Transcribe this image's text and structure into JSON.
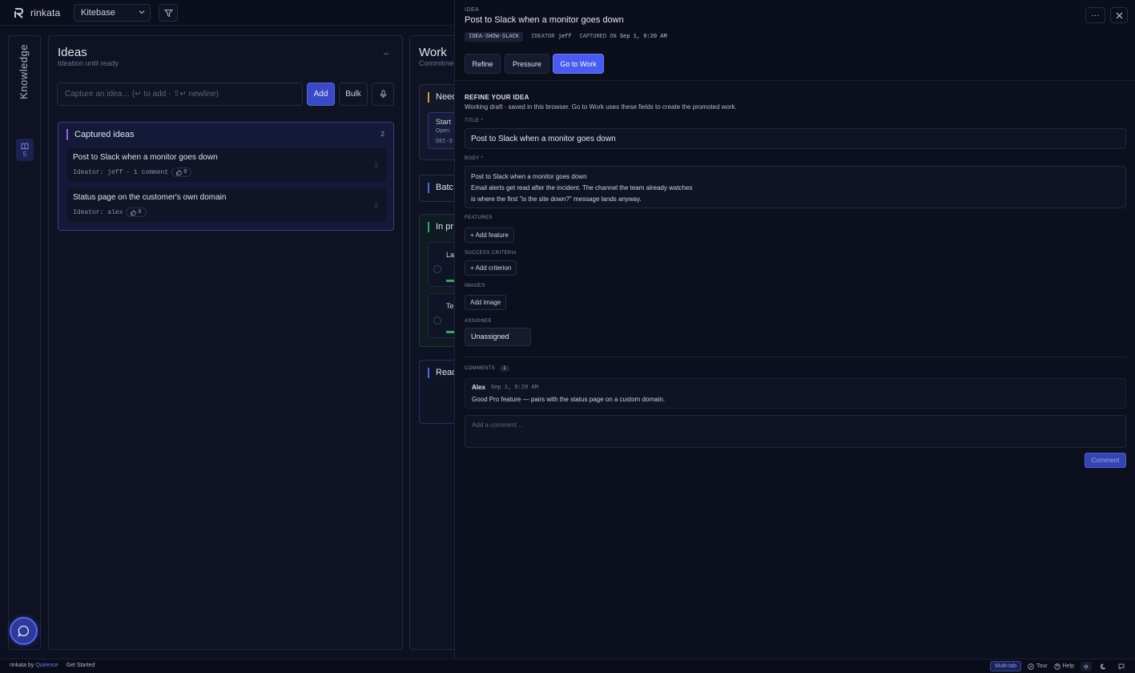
{
  "app": {
    "name": "rinkata"
  },
  "topbar": {
    "workspace": "Kitebase"
  },
  "rail": {
    "label": "Knowledge",
    "count": "5"
  },
  "ideas": {
    "title": "Ideas",
    "subtitle": "Ideation until ready",
    "collapse": "–",
    "capture_placeholder": "Capture an idea… (↵ to add · ⇧↵ newline)",
    "add_label": "Add",
    "bulk_label": "Bulk",
    "captured": {
      "title": "Captured ideas",
      "count": "2",
      "items": [
        {
          "title": "Post to Slack when a monitor goes down",
          "ideator": "Ideator: jeff",
          "comments": "· 1 comment",
          "votes": "0"
        },
        {
          "title": "Status page on the customer's own domain",
          "ideator": "Ideator: alex",
          "comments": "",
          "votes": "0"
        }
      ]
    }
  },
  "work": {
    "title": "Work",
    "subtitle": "Commitments",
    "sections": [
      {
        "label": "Need",
        "color": "#c9a23a"
      },
      {
        "label": "Batc",
        "color": "#4a6ae6"
      },
      {
        "label": "In pr",
        "color": "#2fa86a"
      },
      {
        "label": "Read",
        "color": "#4a6ae6"
      }
    ],
    "snippets": {
      "start": "Start",
      "open": "Open",
      "code": "DEC-S",
      "la": "La",
      "te": "Te"
    }
  },
  "drawer": {
    "kind": "IDEA",
    "title": "Post to Slack when a monitor goes down",
    "tag": "IDEA-SHOW-SLACK",
    "ideator_label": "IDEATOR",
    "ideator": "jeff",
    "captured_label": "CAPTURED ON",
    "captured": "Sep 1, 9:20 AM",
    "more": "···",
    "tabs": {
      "refine": "Refine",
      "pressure": "Pressure",
      "gotowork": "Go to Work"
    },
    "section_title": "REFINE YOUR IDEA",
    "section_sub": "Working draft · saved in this browser. Go to Work uses these fields to create the promoted work.",
    "title_label": "TITLE *",
    "title_value": "Post to Slack when a monitor goes down",
    "body_label": "BODY *",
    "body_lines": [
      "Post to Slack when a monitor goes down",
      "Email alerts get read after the incident. The channel the team already watches",
      "is where the first \"is the site down?\" message lands anyway."
    ],
    "features_label": "FEATURES",
    "add_feature": "+ Add feature",
    "criteria_label": "SUCCESS CRITERIA",
    "add_criterion": "+ Add criterion",
    "images_label": "IMAGES",
    "add_image": "Add image",
    "assignee_label": "ASSIGNEE",
    "assignee": "Unassigned",
    "comments_label": "COMMENTS",
    "comments_count": "1",
    "comment": {
      "author": "Alex",
      "time": "Sep 1, 9:20 AM",
      "text": "Good Pro feature — pairs with the status page on a custom domain."
    },
    "comment_placeholder": "Add a comment…",
    "comment_btn": "Comment"
  },
  "statusbar": {
    "by_prefix": "rinkata by",
    "brand": "Quirence",
    "get_started": "Get Started",
    "multitab": "Multi-tab",
    "tour": "Tour",
    "help": "Help"
  }
}
